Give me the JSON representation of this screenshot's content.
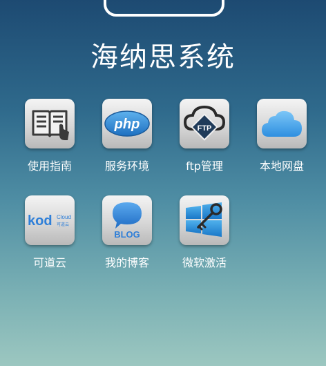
{
  "title": "海纳思系统",
  "apps": [
    {
      "label": "使用指南",
      "icon": "guide-book-icon"
    },
    {
      "label": "服务环境",
      "icon": "php-icon"
    },
    {
      "label": "ftp管理",
      "icon": "ftp-icon"
    },
    {
      "label": "本地网盘",
      "icon": "cloud-icon"
    },
    {
      "label": "可道云",
      "icon": "kod-cloud-icon",
      "icon_text": "kod",
      "icon_subtext_1": "Cloud",
      "icon_subtext_2": "可道云"
    },
    {
      "label": "我的博客",
      "icon": "blog-icon",
      "icon_text": "BLOG"
    },
    {
      "label": "微软激活",
      "icon": "windows-key-icon"
    }
  ],
  "icon_text": {
    "php": "php",
    "ftp": "FTP"
  },
  "colors": {
    "accent_blue": "#2f8fd8",
    "title": "#ffffff"
  }
}
